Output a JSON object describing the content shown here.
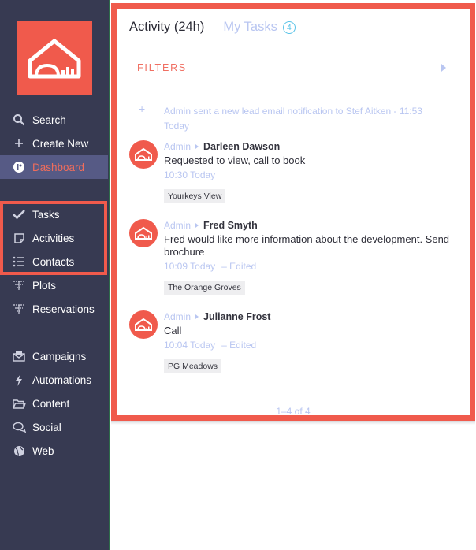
{
  "sidebar": {
    "items": [
      {
        "label": "Search",
        "icon": "search-icon"
      },
      {
        "label": "Create New",
        "icon": "plus-icon"
      },
      {
        "label": "Dashboard",
        "icon": "dashboard-icon",
        "active": true
      },
      {
        "label": "Tasks",
        "icon": "checkmark-icon"
      },
      {
        "label": "Activities",
        "icon": "note-icon"
      },
      {
        "label": "Contacts",
        "icon": "list-icon"
      },
      {
        "label": "Plots",
        "icon": "plots-icon"
      },
      {
        "label": "Reservations",
        "icon": "reservations-icon"
      },
      {
        "label": "Campaigns",
        "icon": "campaigns-icon"
      },
      {
        "label": "Automations",
        "icon": "lightning-icon"
      },
      {
        "label": "Content",
        "icon": "folder-icon"
      },
      {
        "label": "Social",
        "icon": "chat-bubbles-icon"
      },
      {
        "label": "Web",
        "icon": "globe-icon"
      }
    ]
  },
  "tabs": {
    "activity": "Activity (24h)",
    "tasks": "My Tasks",
    "tasks_count": "4"
  },
  "filters_label": "FILTERS",
  "system_notice": "Admin sent a new lead email notification to Stef Aitken - 11:53 Today",
  "feed": [
    {
      "author": "Admin",
      "contact": "Darleen Dawson",
      "message": "Requested to view, call to book",
      "time": "10:30 Today",
      "edited": "",
      "tag": "Yourkeys View"
    },
    {
      "author": "Admin",
      "contact": "Fred Smyth",
      "message": "Fred would like more information about the development. Send brochure",
      "time": "10:09 Today",
      "edited": "– Edited",
      "tag": "The Orange Groves"
    },
    {
      "author": "Admin",
      "contact": "Julianne Frost",
      "message": "Call",
      "time": "10:04 Today",
      "edited": "– Edited",
      "tag": "PG Meadows"
    }
  ],
  "pagination": "1–4 of 4",
  "colors": {
    "sidebar_bg": "#373a52",
    "brand_red": "#f05a4c",
    "active_bg": "#565a85",
    "link_blue": "#b9c6f1",
    "badge_cyan": "#58c3e8"
  }
}
